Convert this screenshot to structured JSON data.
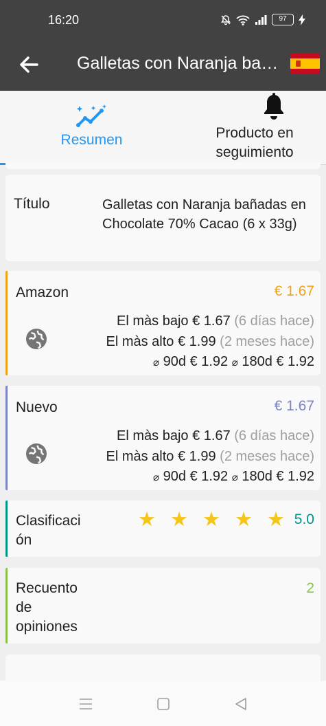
{
  "status_bar": {
    "time": "16:20",
    "battery": "97"
  },
  "app_bar": {
    "title": "Galletas con Naranja bañadas en Chocolate 70% Cacao (6 x 33g)",
    "flag_icon": "spain-flag-icon"
  },
  "tabs": [
    {
      "label": "Resumen",
      "icon": "trend-sparkle-icon",
      "active": true
    },
    {
      "label": "Producto en seguimiento",
      "icon": "bell-icon",
      "active": false
    }
  ],
  "title_card": {
    "label": "Título",
    "value": "Galletas con Naranja bañadas en Chocolate 70% Cacao (6 x 33g)"
  },
  "amazon": {
    "label": "Amazon",
    "price": "€ 1.67",
    "color": "#f0a31a",
    "lowest_label": "El màs bajo",
    "lowest_price": "€ 1.67",
    "lowest_when": "(6 días hace)",
    "highest_label": "El màs alto",
    "highest_price": "€ 1.99",
    "highest_when": "(2 meses hace)",
    "avg_symbol": "⌀",
    "avg90_label": "90d",
    "avg90_price": "€ 1.92",
    "avg180_label": "180d",
    "avg180_price": "€ 1.92"
  },
  "nuevo": {
    "label": "Nuevo",
    "price": "€ 1.67",
    "color": "#7b83c4",
    "lowest_label": "El màs bajo",
    "lowest_price": "€ 1.67",
    "lowest_when": "(6 días hace)",
    "highest_label": "El màs alto",
    "highest_price": "€ 1.99",
    "highest_when": "(2 meses hace)",
    "avg_symbol": "⌀",
    "avg90_label": "90d",
    "avg90_price": "€ 1.92",
    "avg180_label": "180d",
    "avg180_price": "€ 1.92"
  },
  "rating": {
    "label": "Clasificaci ón",
    "value": "5.0",
    "stars": 5,
    "accent": "#009688"
  },
  "reviews": {
    "label": "Recuento de opiniones",
    "value": "2",
    "accent": "#8bc34a"
  },
  "accent_color": "#2196f3"
}
